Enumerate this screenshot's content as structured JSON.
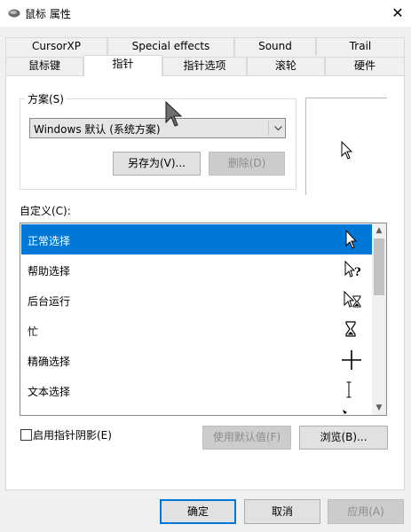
{
  "window": {
    "title": "鼠标 属性",
    "close_glyph": "✕"
  },
  "tabs_row1": [
    {
      "label": "CursorXP"
    },
    {
      "label": "Special effects"
    },
    {
      "label": "Sound"
    },
    {
      "label": "Trail"
    }
  ],
  "tabs_row2": [
    {
      "label": "鼠标键"
    },
    {
      "label": "指针",
      "active": true
    },
    {
      "label": "指针选项"
    },
    {
      "label": "滚轮"
    },
    {
      "label": "硬件"
    }
  ],
  "scheme": {
    "label": "方案(S)",
    "selected": "Windows 默认 (系统方案)",
    "save_as_label": "另存为(V)...",
    "delete_label": "删除(D)"
  },
  "customize": {
    "label": "自定义(C):",
    "items": [
      {
        "label": "正常选择",
        "icon": "arrow-cursor-icon",
        "selected": true
      },
      {
        "label": "帮助选择",
        "icon": "help-cursor-icon"
      },
      {
        "label": "后台运行",
        "icon": "working-cursor-icon"
      },
      {
        "label": "忙",
        "icon": "busy-cursor-icon"
      },
      {
        "label": "精确选择",
        "icon": "crosshair-cursor-icon"
      },
      {
        "label": "文本选择",
        "icon": "text-cursor-icon"
      }
    ]
  },
  "shadow_option": {
    "label": "启用指针阴影(E)",
    "checked": false
  },
  "buttons": {
    "use_default": "使用默认值(F)",
    "browse": "浏览(B)...",
    "ok": "确定",
    "cancel": "取消",
    "apply": "应用(A)"
  },
  "colors": {
    "accent": "#0078d7",
    "panel": "#ffffff",
    "chrome": "#f0f0f0"
  }
}
